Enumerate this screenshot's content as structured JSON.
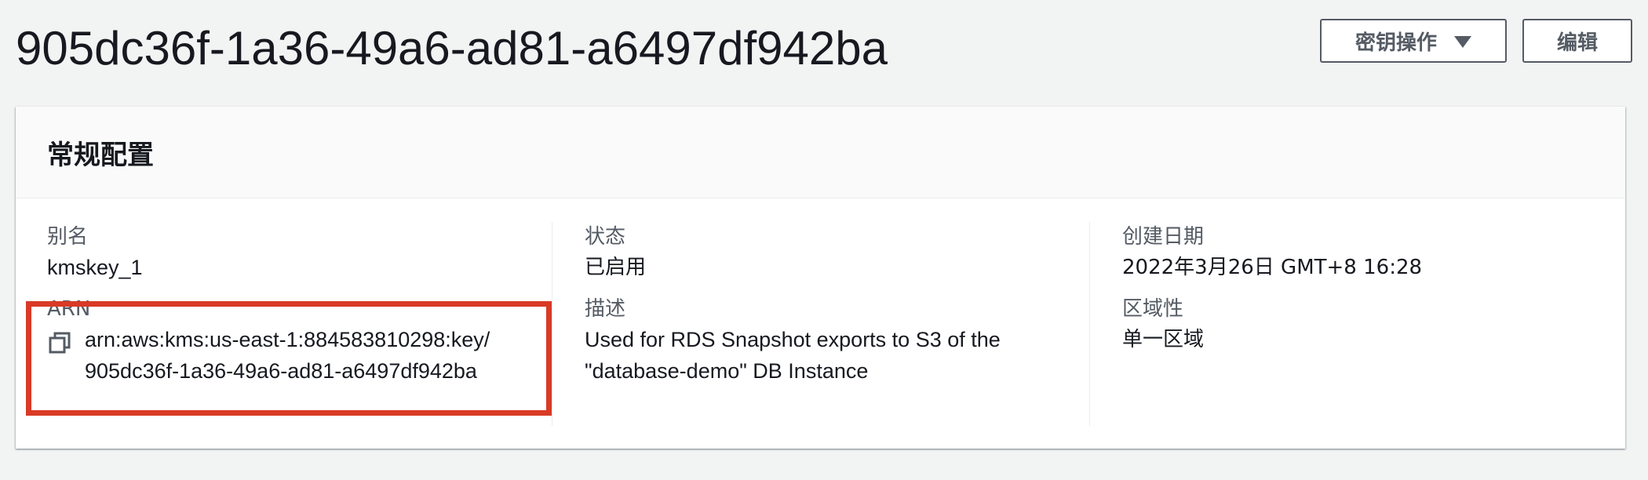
{
  "header": {
    "title": "905dc36f-1a36-49a6-ad81-a6497df942ba",
    "key_actions_label": "密钥操作",
    "edit_label": "编辑"
  },
  "panel": {
    "title": "常规配置",
    "fields": {
      "alias": {
        "label": "别名",
        "value": "kmskey_1"
      },
      "arn": {
        "label": "ARN",
        "value": "arn:aws:kms:us-east-1:884583810298:key/ 905dc36f-1a36-49a6-ad81-a6497df942ba"
      },
      "status": {
        "label": "状态",
        "value": "已启用"
      },
      "description": {
        "label": "描述",
        "value": "Used for RDS Snapshot exports to S3 of the \"database-demo\" DB Instance"
      },
      "created": {
        "label": "创建日期",
        "value": "2022年3月26日 GMT+8 16:28"
      },
      "regionality": {
        "label": "区域性",
        "value": "单一区域"
      }
    }
  },
  "icons": {
    "copy": "copy-icon",
    "dropdown": "caret-down-icon"
  },
  "colors": {
    "highlight_border": "#d93a26",
    "background": "#f2f3f3",
    "text": "#16191f",
    "label": "#545b64"
  }
}
